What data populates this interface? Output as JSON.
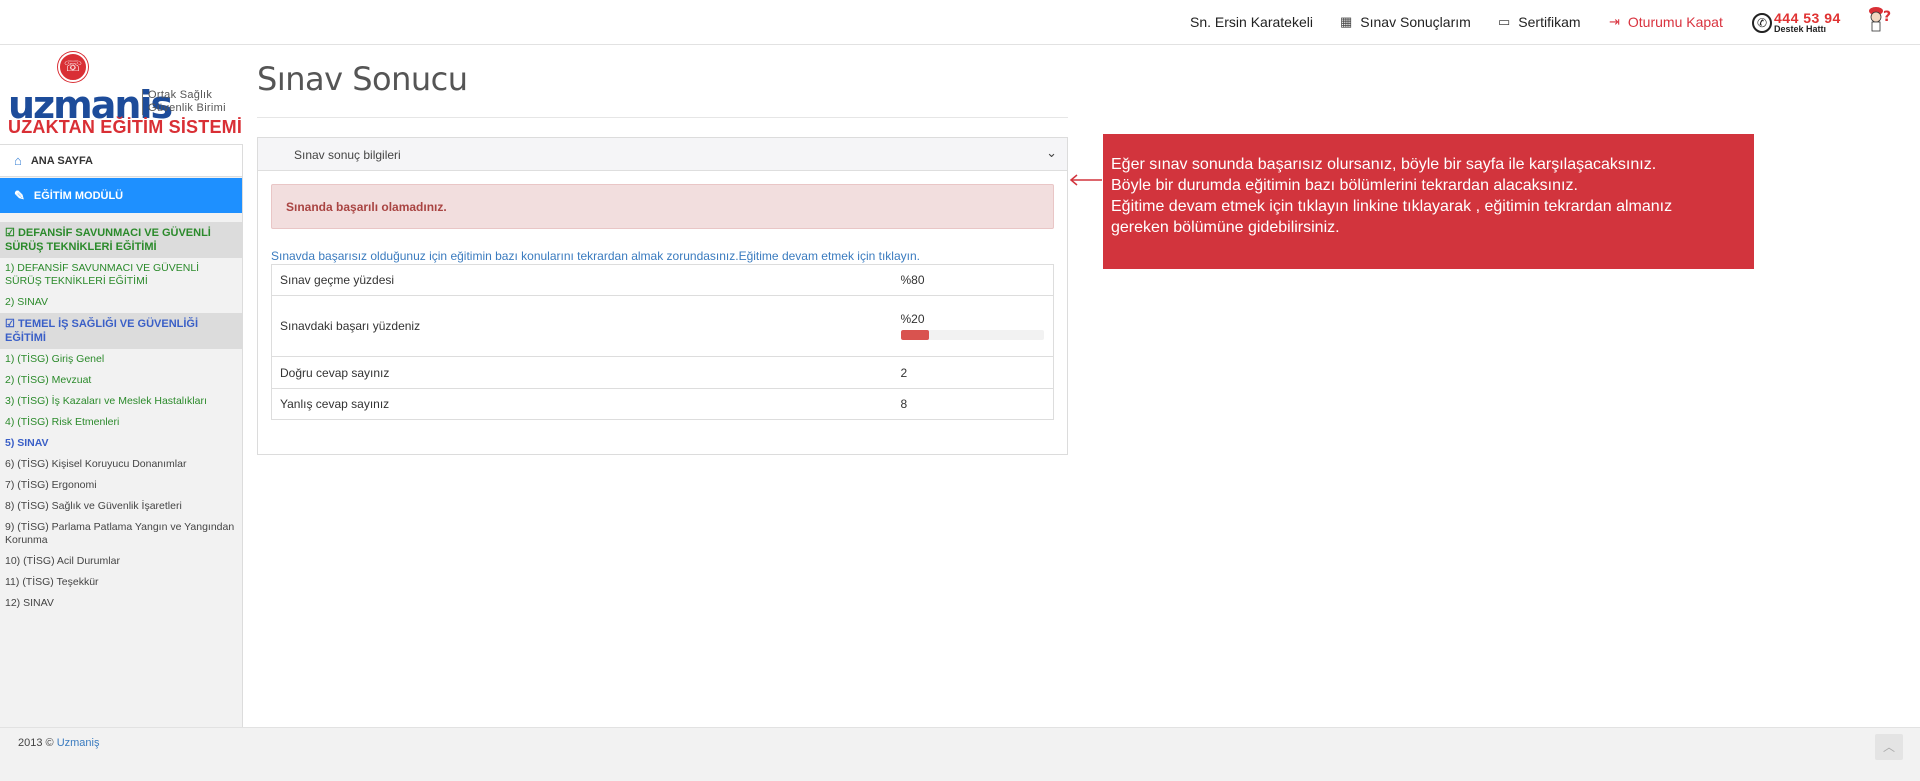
{
  "navbar": {
    "user": "Sn. Ersin Karatekeli",
    "exam_results": "Sınav Sonuçlarım",
    "certificate": "Sertifikam",
    "logout": "Oturumu Kapat",
    "support_number": "444 53 94",
    "support_label": "Destek Hattı",
    "icons": {
      "exam_results": "calendar-icon",
      "certificate": "chat-icon",
      "logout": "logout-icon",
      "support": "phone-icon"
    }
  },
  "sidebar": {
    "logo": {
      "brand": "uzmanis",
      "sub_line1": "Ortak Sağlık",
      "sub_line2": "Güvenlik Birimi",
      "tagline": "UZAKTAN EĞİTİM SİSTEMİ"
    },
    "home": "ANA SAYFA",
    "module": "EĞİTİM MODÜLÜ",
    "sections": [
      {
        "title": "DEFANSİF SAVUNMACI VE GÜVENLİ SÜRÜŞ TEKNİKLERİ EĞİTİMİ",
        "items": [
          {
            "label": "1) DEFANSİF SAVUNMACI VE GÜVENLİ SÜRÜŞ TEKNİKLERİ EĞİTİMİ"
          },
          {
            "label": "2) SINAV"
          }
        ]
      },
      {
        "title": "TEMEL İŞ SAĞLIĞI VE GÜVENLİĞİ EĞİTİMİ",
        "items": [
          {
            "label": "1) (TİSG) Giriş Genel"
          },
          {
            "label": "2) (TİSG) Mevzuat"
          },
          {
            "label": "3) (TİSG) İş Kazaları ve Meslek Hastalıkları"
          },
          {
            "label": "4) (TİSG) Risk Etmenleri"
          },
          {
            "label": "5) SINAV"
          },
          {
            "label": "6) (TİSG) Kişisel Koruyucu Donanımlar"
          },
          {
            "label": "7) (TİSG) Ergonomi"
          },
          {
            "label": "8) (TİSG) Sağlık ve Güvenlik İşaretleri"
          },
          {
            "label": "9) (TİSG) Parlama Patlama Yangın ve Yangından Korunma"
          },
          {
            "label": "10) (TİSG) Acil Durumlar"
          },
          {
            "label": "11) (TİSG) Teşekkür"
          },
          {
            "label": "12) SINAV"
          }
        ]
      }
    ]
  },
  "main": {
    "title": "Sınav Sonucu",
    "panel_title": "Sınav sonuç bilgileri",
    "alert": "Sınanda başarılı olamadınız.",
    "info": "Sınavda başarısız olduğunuz için eğitimin bazı konularını tekrardan almak zorundasınız.Eğitime devam etmek için tıklayın.",
    "rows": [
      {
        "label": "Sınav geçme yüzdesi",
        "value": "%80"
      },
      {
        "label": "Sınavdaki başarı yüzdeniz",
        "value": "%20",
        "progress": 20
      },
      {
        "label": "Doğru cevap sayınız",
        "value": "2"
      },
      {
        "label": "Yanlış cevap sayınız",
        "value": "8"
      }
    ]
  },
  "callout": {
    "line1": "Eğer sınav sonunda başarısız olursanız, böyle bir sayfa ile karşılaşacaksınız.",
    "line2": "Böyle bir durumda eğitimin bazı bölümlerini tekrardan alacaksınız.",
    "line3": "Eğitime devam etmek için tıklayın linkine tıklayarak , eğitimin tekrardan almanız",
    "line4": "gereken bölümüne gidebilirsiniz."
  },
  "footer": {
    "copy": "2013 ©",
    "link": "Uzmaniş"
  },
  "colors": {
    "accent": "#1e90ff",
    "brand_red": "#d92f35",
    "callout": "#d2343d",
    "green": "#2b8a2b",
    "blue": "#3a5fc7"
  }
}
